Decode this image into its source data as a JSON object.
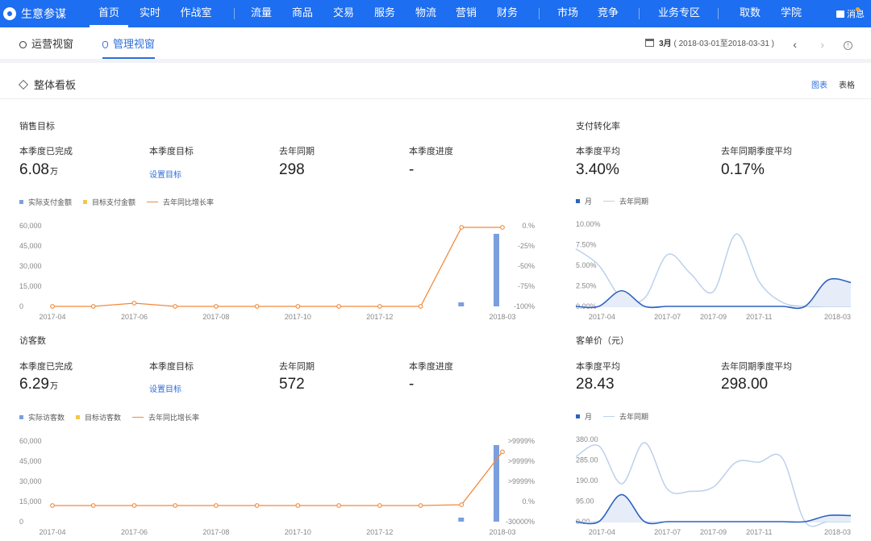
{
  "brand": {
    "name": "生意参谋"
  },
  "topnav": {
    "items": [
      "首页",
      "实时",
      "作战室",
      "流量",
      "商品",
      "交易",
      "服务",
      "物流",
      "营销",
      "财务",
      "市场",
      "竞争",
      "业务专区",
      "取数",
      "学院"
    ],
    "active": "首页",
    "message_label": "消息"
  },
  "subnav": {
    "tabs": [
      "运营视窗",
      "管理视窗"
    ],
    "active_tab": "管理视窗",
    "date_month": "3月",
    "date_range": "( 2018-03-01至2018-03-31 )"
  },
  "board": {
    "title": "整体看板",
    "view_chart": "图表",
    "view_table": "表格"
  },
  "sales": {
    "title": "销售目标",
    "kpis": [
      {
        "label": "本季度已完成",
        "value": "6.08",
        "unit": "万"
      },
      {
        "label": "本季度目标",
        "link": "设置目标"
      },
      {
        "label": "去年同期",
        "value": "298"
      },
      {
        "label": "本季度进度",
        "value": "-"
      }
    ],
    "legend": [
      "实际支付金额",
      "目标支付金额",
      "去年同比增长率"
    ]
  },
  "visitors": {
    "title": "访客数",
    "kpis": [
      {
        "label": "本季度已完成",
        "value": "6.29",
        "unit": "万"
      },
      {
        "label": "本季度目标",
        "link": "设置目标"
      },
      {
        "label": "去年同期",
        "value": "572"
      },
      {
        "label": "本季度进度",
        "value": "-"
      }
    ],
    "legend": [
      "实际访客数",
      "目标访客数",
      "去年同比增长率"
    ]
  },
  "conversion": {
    "title": "支付转化率",
    "kpis": [
      {
        "label": "本季度平均",
        "value": "3.40%"
      },
      {
        "label": "去年同期季度平均",
        "value": "0.17%"
      }
    ],
    "legend": [
      "月",
      "去年同期"
    ]
  },
  "unit_price": {
    "title": "客单价（元）",
    "kpis": [
      {
        "label": "本季度平均",
        "value": "28.43"
      },
      {
        "label": "去年同期季度平均",
        "value": "298.00"
      }
    ],
    "legend": [
      "月",
      "去年同期"
    ]
  },
  "colors": {
    "nav": "#1d6ef0",
    "accent": "#2f6fd8",
    "bar": "#7b9fde",
    "target": "#f5c842",
    "growth": "#f08a3c",
    "month_line": "#2d62c0",
    "lastyear_line": "#bcd0ec"
  },
  "chart_data": [
    {
      "id": "sales",
      "type": "bar",
      "x": [
        "2017-04",
        "2017-05",
        "2017-06",
        "2017-07",
        "2017-08",
        "2017-09",
        "2017-10",
        "2017-11",
        "2017-12",
        "2018-01",
        "2018-02",
        "2018-03"
      ],
      "xticks": [
        "2017-04",
        "2017-06",
        "2017-08",
        "2017-10",
        "2017-12",
        "2018-03"
      ],
      "yticks_left": [
        "60,000",
        "45,000",
        "30,000",
        "15,000",
        "0"
      ],
      "yticks_right": [
        "0.%",
        "-25%",
        "-50%",
        "-75%",
        "-100%"
      ],
      "ylim": [
        0,
        60000
      ],
      "series": [
        {
          "name": "实际支付金额",
          "type": "bar",
          "values": [
            0,
            0,
            0,
            0,
            0,
            0,
            0,
            0,
            0,
            0,
            3000,
            54000
          ]
        },
        {
          "name": "去年同比增长率",
          "type": "line",
          "values": [
            -100,
            -100,
            -96,
            -100,
            -100,
            -100,
            -100,
            -100,
            -100,
            -100,
            -2,
            -2
          ]
        }
      ],
      "right_ylim": [
        -100,
        0
      ]
    },
    {
      "id": "visitors",
      "type": "bar",
      "x": [
        "2017-04",
        "2017-05",
        "2017-06",
        "2017-07",
        "2017-08",
        "2017-09",
        "2017-10",
        "2017-11",
        "2017-12",
        "2018-01",
        "2018-02",
        "2018-03"
      ],
      "xticks": [
        "2017-04",
        "2017-06",
        "2017-08",
        "2017-10",
        "2017-12",
        "2018-03"
      ],
      "yticks_left": [
        "60,000",
        "45,000",
        "30,000",
        "15,000",
        "0"
      ],
      "yticks_right": [
        ">9999%",
        ">9999%",
        ">9999%",
        "0.%",
        "-30000%"
      ],
      "ylim": [
        0,
        60000
      ],
      "series": [
        {
          "name": "实际访客数",
          "type": "bar",
          "values": [
            0,
            0,
            0,
            0,
            0,
            0,
            0,
            0,
            0,
            0,
            3000,
            57000
          ]
        },
        {
          "name": "去年同比增长率",
          "type": "line",
          "values": [
            0,
            0,
            0,
            0,
            0,
            0,
            0,
            0,
            0,
            0,
            0.15,
            10
          ]
        }
      ],
      "right_ylim": [
        -3,
        12
      ]
    },
    {
      "id": "conversion",
      "type": "area",
      "x": [
        "2017-03",
        "2017-04",
        "2017-05",
        "2017-06",
        "2017-07",
        "2017-08",
        "2017-09",
        "2017-10",
        "2017-11",
        "2017-12",
        "2018-01",
        "2018-02",
        "2018-03"
      ],
      "xticks": [
        "2017-04",
        "2017-07",
        "2017-09",
        "2017-11",
        "2018-03"
      ],
      "yticks": [
        "10.00%",
        "7.50%",
        "5.00%",
        "2.50%",
        "0.00%"
      ],
      "ylim": [
        0,
        10
      ],
      "series": [
        {
          "name": "月",
          "values": [
            0,
            0,
            1.9,
            0,
            0,
            0,
            0,
            0,
            0,
            0,
            0,
            3.2,
            2.9
          ]
        },
        {
          "name": "去年同期",
          "values": [
            7.0,
            5.0,
            1.0,
            1.0,
            6.3,
            4.0,
            1.8,
            8.8,
            3.0,
            0.5,
            0,
            0,
            0
          ]
        }
      ]
    },
    {
      "id": "unit_price",
      "type": "area",
      "x": [
        "2017-03",
        "2017-04",
        "2017-05",
        "2017-06",
        "2017-07",
        "2017-08",
        "2017-09",
        "2017-10",
        "2017-11",
        "2017-12",
        "2018-01",
        "2018-02",
        "2018-03"
      ],
      "xticks": [
        "2017-04",
        "2017-07",
        "2017-09",
        "2017-11",
        "2018-03"
      ],
      "yticks": [
        "380.00",
        "285.00",
        "190.00",
        "95.00",
        "0.00"
      ],
      "ylim": [
        0,
        380
      ],
      "series": [
        {
          "name": "月",
          "values": [
            0,
            0,
            125,
            0,
            0,
            0,
            0,
            0,
            0,
            0,
            0,
            28,
            28
          ]
        },
        {
          "name": "去年同期",
          "values": [
            300,
            350,
            175,
            365,
            150,
            140,
            160,
            275,
            275,
            295,
            0,
            0,
            0
          ]
        }
      ]
    }
  ]
}
